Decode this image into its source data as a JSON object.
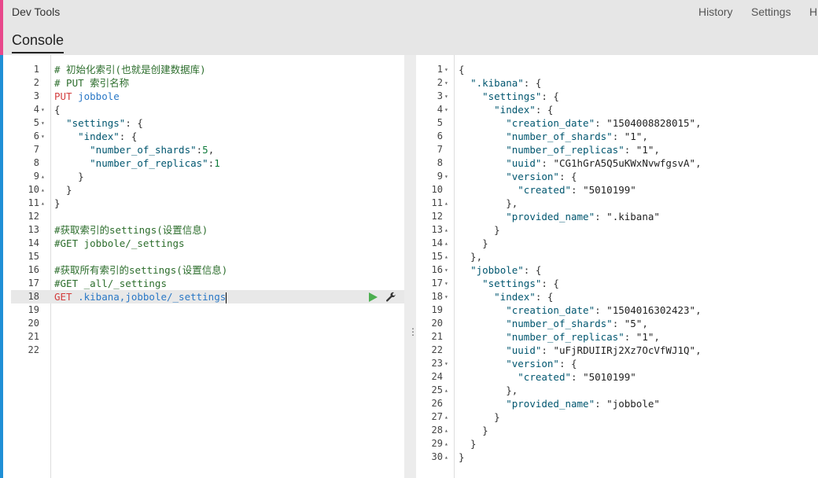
{
  "header": {
    "app_title": "Dev Tools",
    "nav": [
      {
        "label": "History"
      },
      {
        "label": "Settings"
      },
      {
        "label": "H"
      }
    ],
    "tab_console": "Console"
  },
  "colors": {
    "accent_pink": "#e8488b",
    "accent_blue": "#1f8fd6",
    "run_button": "#4caf50"
  },
  "editor": {
    "lines": [
      {
        "n": "1",
        "f": "",
        "tokens": [
          [
            "comment",
            "# 初始化索引(也就是创建数据库)"
          ]
        ]
      },
      {
        "n": "2",
        "f": "",
        "tokens": [
          [
            "comment",
            "# PUT 索引名称"
          ]
        ]
      },
      {
        "n": "3",
        "f": "",
        "tokens": [
          [
            "method",
            "PUT "
          ],
          [
            "url",
            "jobbole"
          ]
        ]
      },
      {
        "n": "4",
        "f": "▾",
        "tokens": [
          [
            "punc",
            "{"
          ]
        ]
      },
      {
        "n": "5",
        "f": "▾",
        "tokens": [
          [
            "punc",
            "  "
          ],
          [
            "key",
            "\"settings\""
          ],
          [
            "punc",
            ": {"
          ]
        ]
      },
      {
        "n": "6",
        "f": "▾",
        "tokens": [
          [
            "punc",
            "    "
          ],
          [
            "key",
            "\"index\""
          ],
          [
            "punc",
            ": {"
          ]
        ]
      },
      {
        "n": "7",
        "f": "",
        "tokens": [
          [
            "punc",
            "      "
          ],
          [
            "key",
            "\"number_of_shards\""
          ],
          [
            "punc",
            ":"
          ],
          [
            "num",
            "5"
          ],
          [
            "punc",
            ","
          ]
        ]
      },
      {
        "n": "8",
        "f": "",
        "tokens": [
          [
            "punc",
            "      "
          ],
          [
            "key",
            "\"number_of_replicas\""
          ],
          [
            "punc",
            ":"
          ],
          [
            "num",
            "1"
          ]
        ]
      },
      {
        "n": "9",
        "f": "▴",
        "tokens": [
          [
            "punc",
            "    }"
          ]
        ]
      },
      {
        "n": "10",
        "f": "▴",
        "tokens": [
          [
            "punc",
            "  }"
          ]
        ]
      },
      {
        "n": "11",
        "f": "▴",
        "tokens": [
          [
            "punc",
            "}"
          ]
        ]
      },
      {
        "n": "12",
        "f": "",
        "tokens": []
      },
      {
        "n": "13",
        "f": "",
        "tokens": [
          [
            "comment",
            "#获取索引的settings(设置信息)"
          ]
        ]
      },
      {
        "n": "14",
        "f": "",
        "tokens": [
          [
            "comment",
            "#GET jobbole/_settings"
          ]
        ]
      },
      {
        "n": "15",
        "f": "",
        "tokens": []
      },
      {
        "n": "16",
        "f": "",
        "tokens": [
          [
            "comment",
            "#获取所有索引的settings(设置信息)"
          ]
        ]
      },
      {
        "n": "17",
        "f": "",
        "tokens": [
          [
            "comment",
            "#GET _all/_settings"
          ]
        ]
      },
      {
        "n": "18",
        "f": "",
        "active": true,
        "tokens": [
          [
            "method",
            "GET "
          ],
          [
            "url",
            ".kibana,jobbole/_settings"
          ]
        ]
      },
      {
        "n": "19",
        "f": "",
        "tokens": []
      },
      {
        "n": "20",
        "f": "",
        "tokens": []
      },
      {
        "n": "21",
        "f": "",
        "tokens": []
      },
      {
        "n": "22",
        "f": "",
        "tokens": []
      }
    ]
  },
  "output": {
    "lines": [
      {
        "n": "1",
        "f": "▾",
        "tokens": [
          [
            "punc",
            "{"
          ]
        ]
      },
      {
        "n": "2",
        "f": "▾",
        "tokens": [
          [
            "punc",
            "  "
          ],
          [
            "key",
            "\".kibana\""
          ],
          [
            "punc",
            ": {"
          ]
        ]
      },
      {
        "n": "3",
        "f": "▾",
        "tokens": [
          [
            "punc",
            "    "
          ],
          [
            "key",
            "\"settings\""
          ],
          [
            "punc",
            ": {"
          ]
        ]
      },
      {
        "n": "4",
        "f": "▾",
        "tokens": [
          [
            "punc",
            "      "
          ],
          [
            "key",
            "\"index\""
          ],
          [
            "punc",
            ": {"
          ]
        ]
      },
      {
        "n": "5",
        "f": "",
        "tokens": [
          [
            "punc",
            "        "
          ],
          [
            "key",
            "\"creation_date\""
          ],
          [
            "punc",
            ": "
          ],
          [
            "str",
            "\"1504008828015\""
          ],
          [
            "punc",
            ","
          ]
        ]
      },
      {
        "n": "6",
        "f": "",
        "tokens": [
          [
            "punc",
            "        "
          ],
          [
            "key",
            "\"number_of_shards\""
          ],
          [
            "punc",
            ": "
          ],
          [
            "str",
            "\"1\""
          ],
          [
            "punc",
            ","
          ]
        ]
      },
      {
        "n": "7",
        "f": "",
        "tokens": [
          [
            "punc",
            "        "
          ],
          [
            "key",
            "\"number_of_replicas\""
          ],
          [
            "punc",
            ": "
          ],
          [
            "str",
            "\"1\""
          ],
          [
            "punc",
            ","
          ]
        ]
      },
      {
        "n": "8",
        "f": "",
        "tokens": [
          [
            "punc",
            "        "
          ],
          [
            "key",
            "\"uuid\""
          ],
          [
            "punc",
            ": "
          ],
          [
            "str",
            "\"CG1hGrA5Q5uKWxNvwfgsvA\""
          ],
          [
            "punc",
            ","
          ]
        ]
      },
      {
        "n": "9",
        "f": "▾",
        "tokens": [
          [
            "punc",
            "        "
          ],
          [
            "key",
            "\"version\""
          ],
          [
            "punc",
            ": {"
          ]
        ]
      },
      {
        "n": "10",
        "f": "",
        "tokens": [
          [
            "punc",
            "          "
          ],
          [
            "key",
            "\"created\""
          ],
          [
            "punc",
            ": "
          ],
          [
            "str",
            "\"5010199\""
          ]
        ]
      },
      {
        "n": "11",
        "f": "▴",
        "tokens": [
          [
            "punc",
            "        },"
          ]
        ]
      },
      {
        "n": "12",
        "f": "",
        "tokens": [
          [
            "punc",
            "        "
          ],
          [
            "key",
            "\"provided_name\""
          ],
          [
            "punc",
            ": "
          ],
          [
            "str",
            "\".kibana\""
          ]
        ]
      },
      {
        "n": "13",
        "f": "▴",
        "tokens": [
          [
            "punc",
            "      }"
          ]
        ]
      },
      {
        "n": "14",
        "f": "▴",
        "tokens": [
          [
            "punc",
            "    }"
          ]
        ]
      },
      {
        "n": "15",
        "f": "▴",
        "tokens": [
          [
            "punc",
            "  },"
          ]
        ]
      },
      {
        "n": "16",
        "f": "▾",
        "tokens": [
          [
            "punc",
            "  "
          ],
          [
            "key",
            "\"jobbole\""
          ],
          [
            "punc",
            ": {"
          ]
        ]
      },
      {
        "n": "17",
        "f": "▾",
        "tokens": [
          [
            "punc",
            "    "
          ],
          [
            "key",
            "\"settings\""
          ],
          [
            "punc",
            ": {"
          ]
        ]
      },
      {
        "n": "18",
        "f": "▾",
        "tokens": [
          [
            "punc",
            "      "
          ],
          [
            "key",
            "\"index\""
          ],
          [
            "punc",
            ": {"
          ]
        ]
      },
      {
        "n": "19",
        "f": "",
        "tokens": [
          [
            "punc",
            "        "
          ],
          [
            "key",
            "\"creation_date\""
          ],
          [
            "punc",
            ": "
          ],
          [
            "str",
            "\"1504016302423\""
          ],
          [
            "punc",
            ","
          ]
        ]
      },
      {
        "n": "20",
        "f": "",
        "tokens": [
          [
            "punc",
            "        "
          ],
          [
            "key",
            "\"number_of_shards\""
          ],
          [
            "punc",
            ": "
          ],
          [
            "str",
            "\"5\""
          ],
          [
            "punc",
            ","
          ]
        ]
      },
      {
        "n": "21",
        "f": "",
        "tokens": [
          [
            "punc",
            "        "
          ],
          [
            "key",
            "\"number_of_replicas\""
          ],
          [
            "punc",
            ": "
          ],
          [
            "str",
            "\"1\""
          ],
          [
            "punc",
            ","
          ]
        ]
      },
      {
        "n": "22",
        "f": "",
        "tokens": [
          [
            "punc",
            "        "
          ],
          [
            "key",
            "\"uuid\""
          ],
          [
            "punc",
            ": "
          ],
          [
            "str",
            "\"uFjRDUIIRj2Xz7OcVfWJ1Q\""
          ],
          [
            "punc",
            ","
          ]
        ]
      },
      {
        "n": "23",
        "f": "▾",
        "tokens": [
          [
            "punc",
            "        "
          ],
          [
            "key",
            "\"version\""
          ],
          [
            "punc",
            ": {"
          ]
        ]
      },
      {
        "n": "24",
        "f": "",
        "tokens": [
          [
            "punc",
            "          "
          ],
          [
            "key",
            "\"created\""
          ],
          [
            "punc",
            ": "
          ],
          [
            "str",
            "\"5010199\""
          ]
        ]
      },
      {
        "n": "25",
        "f": "▴",
        "tokens": [
          [
            "punc",
            "        },"
          ]
        ]
      },
      {
        "n": "26",
        "f": "",
        "tokens": [
          [
            "punc",
            "        "
          ],
          [
            "key",
            "\"provided_name\""
          ],
          [
            "punc",
            ": "
          ],
          [
            "str",
            "\"jobbole\""
          ]
        ]
      },
      {
        "n": "27",
        "f": "▴",
        "tokens": [
          [
            "punc",
            "      }"
          ]
        ]
      },
      {
        "n": "28",
        "f": "▴",
        "tokens": [
          [
            "punc",
            "    }"
          ]
        ]
      },
      {
        "n": "29",
        "f": "▴",
        "tokens": [
          [
            "punc",
            "  }"
          ]
        ]
      },
      {
        "n": "30",
        "f": "▴",
        "tokens": [
          [
            "punc",
            "}"
          ]
        ]
      }
    ]
  },
  "icons": {
    "run": "play-icon",
    "settings": "wrench-icon",
    "resize": "vertical-dots-icon"
  },
  "resize_glyph": "⋮"
}
